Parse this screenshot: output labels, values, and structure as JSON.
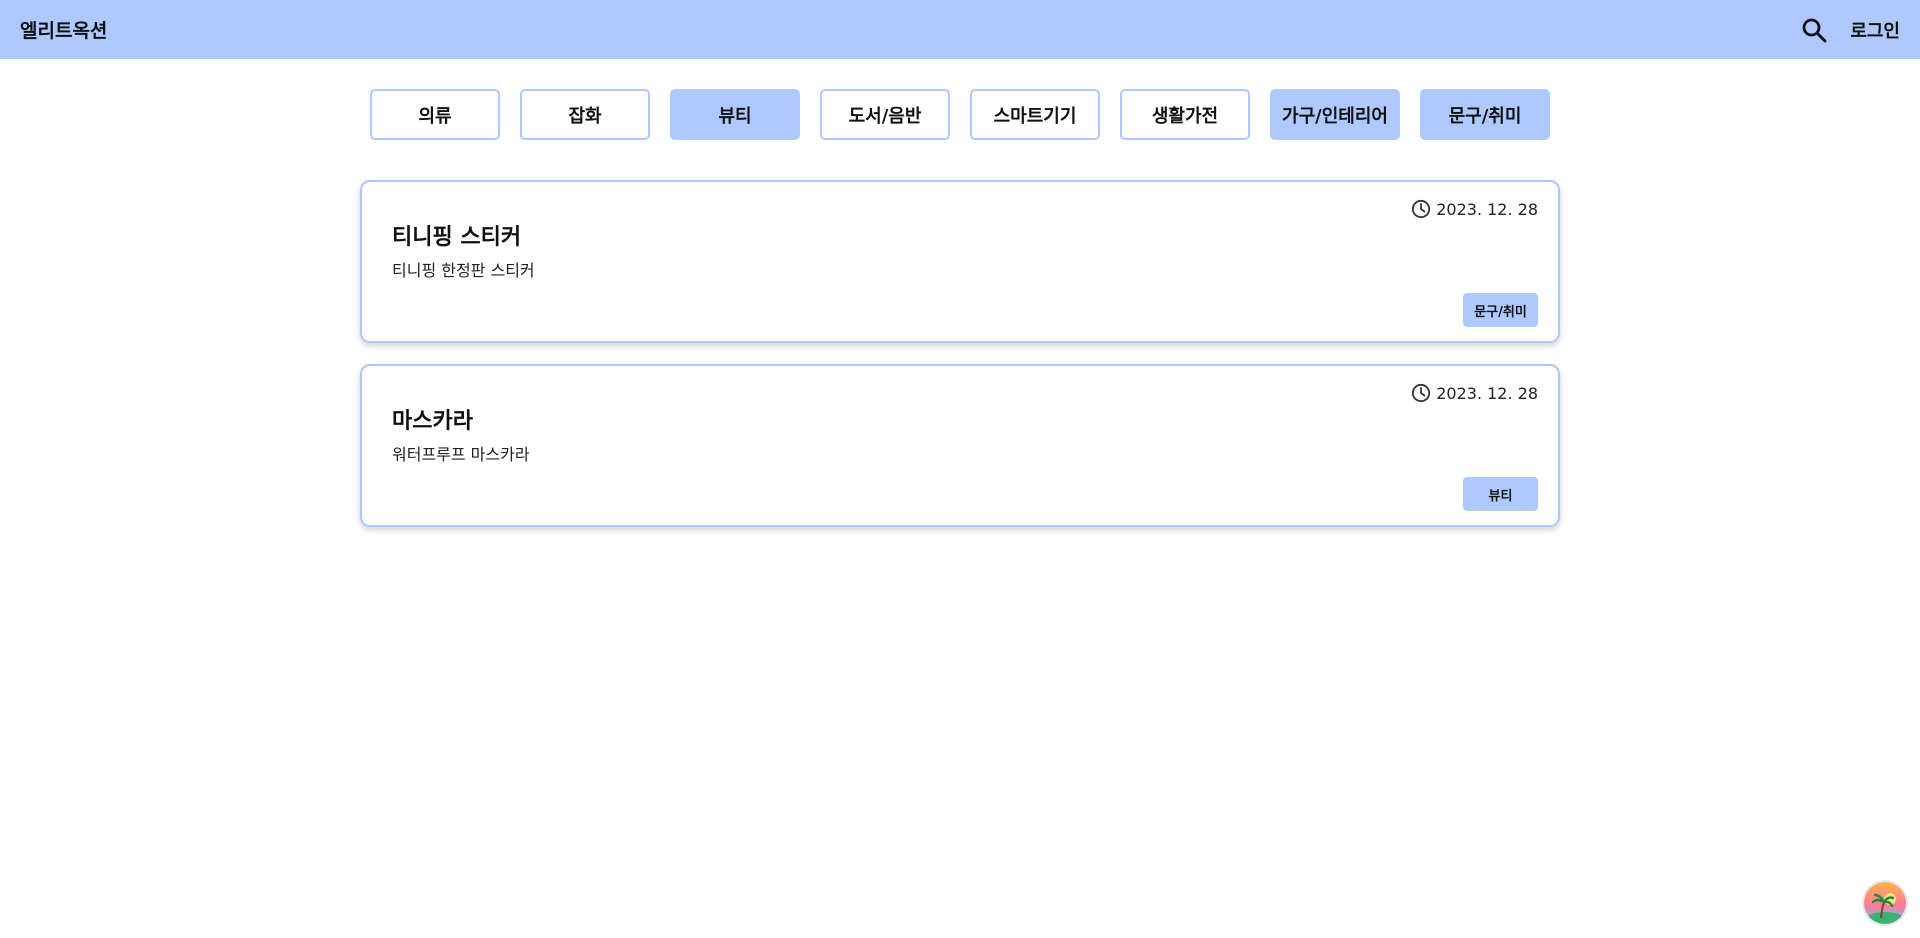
{
  "header": {
    "brand": "엘리트옥션",
    "search_icon": "search-icon",
    "login_label": "로그인",
    "background": "#aec9ff"
  },
  "categories": [
    {
      "label": "의류",
      "active": false
    },
    {
      "label": "잡화",
      "active": false
    },
    {
      "label": "뷰티",
      "active": true
    },
    {
      "label": "도서/음반",
      "active": false
    },
    {
      "label": "스마트기기",
      "active": false
    },
    {
      "label": "생활가전",
      "active": false
    },
    {
      "label": "가구/인테리어",
      "active": true
    },
    {
      "label": "문구/취미",
      "active": true
    }
  ],
  "posts": [
    {
      "title": "티니핑 스티커",
      "description": "티니핑 한정판 스티커",
      "date": "2023. 12. 28",
      "tag": "문구/취미"
    },
    {
      "title": "마스카라",
      "description": "워터프루프 마스카라",
      "date": "2023. 12. 28",
      "tag": "뷰티"
    }
  ],
  "colors": {
    "accent": "#aec9ff",
    "text": "#111111"
  },
  "corner_widget": {
    "icon": "palm-island-avatar-icon"
  }
}
